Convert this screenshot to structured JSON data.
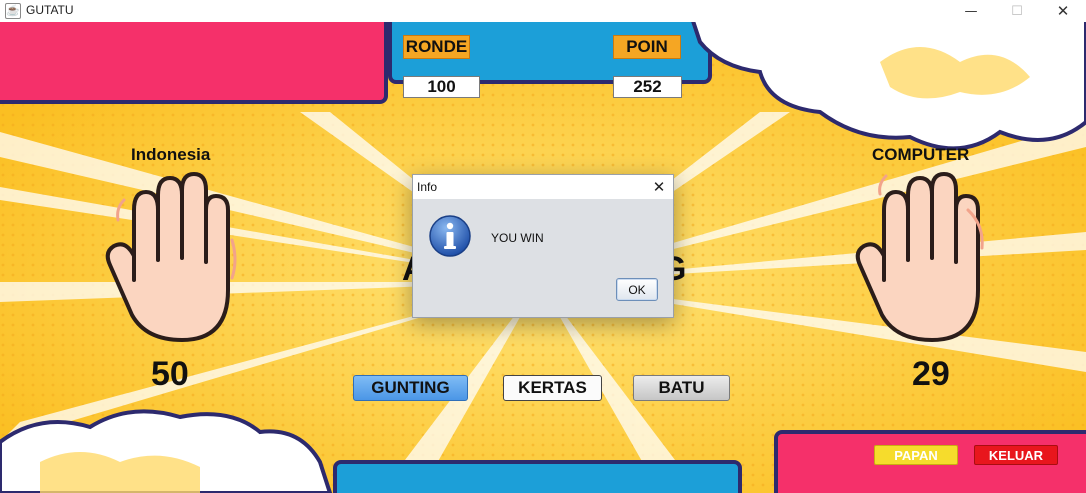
{
  "window": {
    "title": "GUTATU",
    "icon": "java-cup-icon",
    "controls": {
      "minimize": "—",
      "maximize": "☐",
      "close": "✕"
    }
  },
  "game": {
    "ronde_label": "RONDE",
    "ronde_value": "100",
    "poin_label": "POIN",
    "poin_value": "252",
    "player_name": "Indonesia",
    "computer_name": "COMPUTER",
    "player_score": "50",
    "computer_score": "29",
    "player_hand": "open-hand-paper",
    "computer_hand": "open-hand-paper",
    "choices": [
      "GUNTING",
      "KERTAS",
      "BATU"
    ],
    "papan_label": "PAPAN",
    "keluar_label": "KELUAR"
  },
  "dialog": {
    "title": "Info",
    "close": "✕",
    "icon": "info-icon",
    "message": "YOU WIN",
    "ok_label": "OK"
  },
  "colors": {
    "background_yellow": "#fbc52e",
    "panel_pink": "#f5306a",
    "panel_blue": "#1c9fd8",
    "outline_navy": "#2d2a6e",
    "label_orange": "#f5a623",
    "button_blue": "#4b96e6",
    "papan_yellow": "#f6dc2c",
    "keluar_red": "#e8161c"
  }
}
